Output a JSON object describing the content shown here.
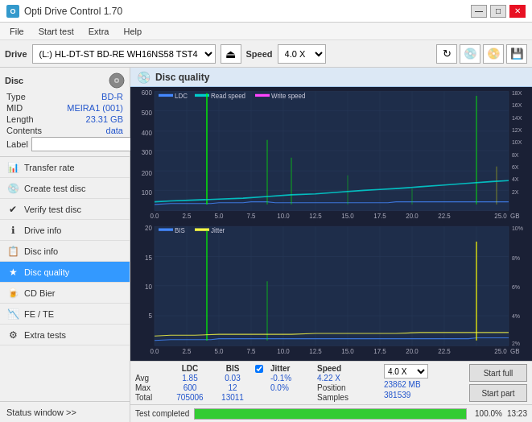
{
  "titlebar": {
    "title": "Opti Drive Control 1.70",
    "icon": "O",
    "minimize": "—",
    "maximize": "□",
    "close": "✕"
  },
  "menubar": {
    "items": [
      "File",
      "Start test",
      "Extra",
      "Help"
    ]
  },
  "drivebar": {
    "drive_label": "Drive",
    "drive_value": "(L:)  HL-DT-ST BD-RE  WH16NS58 TST4",
    "speed_label": "Speed",
    "speed_value": "4.0 X"
  },
  "disc": {
    "title": "Disc",
    "type_label": "Type",
    "type_value": "BD-R",
    "mid_label": "MID",
    "mid_value": "MEIRA1 (001)",
    "length_label": "Length",
    "length_value": "23.31 GB",
    "contents_label": "Contents",
    "contents_value": "data",
    "label_label": "Label"
  },
  "nav": {
    "items": [
      {
        "id": "transfer-rate",
        "label": "Transfer rate",
        "icon": "📊"
      },
      {
        "id": "create-test-disc",
        "label": "Create test disc",
        "icon": "💿"
      },
      {
        "id": "verify-test-disc",
        "label": "Verify test disc",
        "icon": "✔"
      },
      {
        "id": "drive-info",
        "label": "Drive info",
        "icon": "ℹ"
      },
      {
        "id": "disc-info",
        "label": "Disc info",
        "icon": "📋"
      },
      {
        "id": "disc-quality",
        "label": "Disc quality",
        "icon": "★",
        "active": true
      },
      {
        "id": "cd-bier",
        "label": "CD Bier",
        "icon": "🍺"
      },
      {
        "id": "fe-te",
        "label": "FE / TE",
        "icon": "📉"
      },
      {
        "id": "extra-tests",
        "label": "Extra tests",
        "icon": "⚙"
      }
    ],
    "status_window": "Status window >>"
  },
  "disc_quality": {
    "title": "Disc quality",
    "legend_ldc": "LDC",
    "legend_read": "Read speed",
    "legend_write": "Write speed",
    "legend_bis": "BIS",
    "legend_jitter": "Jitter",
    "y_max_top": 600,
    "y_labels_top": [
      "600",
      "500",
      "400",
      "300",
      "200",
      "100"
    ],
    "y_labels_right_top": [
      "18X",
      "16X",
      "14X",
      "12X",
      "10X",
      "8X",
      "6X",
      "4X",
      "2X"
    ],
    "x_labels": [
      "0.0",
      "2.5",
      "5.0",
      "7.5",
      "10.0",
      "12.5",
      "15.0",
      "17.5",
      "20.0",
      "22.5",
      "25.0"
    ],
    "x_unit": "GB",
    "y_max_bottom": 20,
    "y_labels_bottom": [
      "20",
      "15",
      "10",
      "5"
    ],
    "y_labels_right_bottom": [
      "10%",
      "8%",
      "6%",
      "4%",
      "2%"
    ]
  },
  "stats": {
    "avg_label": "Avg",
    "max_label": "Max",
    "total_label": "Total",
    "ldc_header": "LDC",
    "bis_header": "BIS",
    "jitter_label": "Jitter",
    "speed_label": "Speed",
    "position_label": "Position",
    "samples_label": "Samples",
    "ldc_avg": "1.85",
    "ldc_max": "600",
    "ldc_total": "705006",
    "bis_avg": "0.03",
    "bis_max": "12",
    "bis_total": "13011",
    "jitter_avg": "-0.1%",
    "jitter_max": "0.0%",
    "speed_val": "4.22 X",
    "speed_select": "4.0 X",
    "position_val": "23862 MB",
    "samples_val": "381539",
    "start_full": "Start full",
    "start_part": "Start part"
  },
  "progress": {
    "label": "Test completed",
    "percent": "100.0%",
    "time": "13:23"
  },
  "colors": {
    "ldc_color": "#4488ff",
    "read_speed_color": "#00dddd",
    "write_speed_color": "#ff44ff",
    "bis_color": "#4488ff",
    "jitter_color": "#ffff00",
    "grid_color": "#2a3a5a",
    "bg_color": "#1a2035",
    "spike_color": "#00ff00"
  }
}
